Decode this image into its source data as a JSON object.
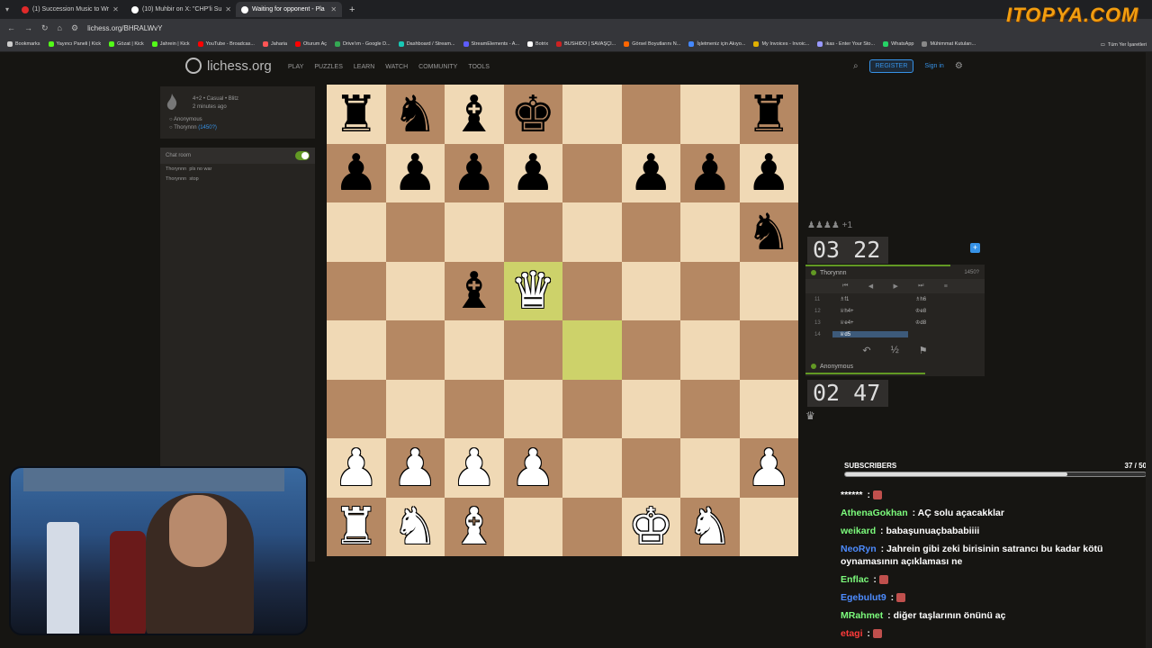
{
  "tabs": [
    {
      "label": "(1) Succession Music to Wr",
      "favicon_color": "#e02a2a",
      "active": false
    },
    {
      "label": "(10) Muhbir on X: \"CHP'li Su",
      "favicon_color": "#ffffff",
      "active": false
    },
    {
      "label": "Waiting for opponent - Pla",
      "favicon_color": "#ffffff",
      "active": true
    }
  ],
  "new_tab": "+",
  "url": "lichess.org/BHRALWvY",
  "bookmarks": [
    {
      "label": "Bookmarks",
      "color": "#cccccc"
    },
    {
      "label": "Yayıncı Paneli | Kick",
      "color": "#53fc18"
    },
    {
      "label": "Gözat | Kick",
      "color": "#53fc18"
    },
    {
      "label": "Jahrein | Kick",
      "color": "#53fc18"
    },
    {
      "label": "YouTube - Broadcas...",
      "color": "#ff0000"
    },
    {
      "label": "Jaharia",
      "color": "#ff5555"
    },
    {
      "label": "Oturum Aç",
      "color": "#ff0000"
    },
    {
      "label": "Drive'ım - Google D...",
      "color": "#34a853"
    },
    {
      "label": "Dashboard / Stream...",
      "color": "#18c8b5"
    },
    {
      "label": "StreamElements - A...",
      "color": "#5d5dff"
    },
    {
      "label": "Botrix",
      "color": "#ffffff"
    },
    {
      "label": "BUSHIDO | SAVAŞÇI...",
      "color": "#cc2222"
    },
    {
      "label": "Görsel Boyutlarını N...",
      "color": "#ff6600"
    },
    {
      "label": "İşletmeniz için Akıyo...",
      "color": "#4488ff"
    },
    {
      "label": "My Invoices - Invoic...",
      "color": "#e0b000"
    },
    {
      "label": "ikas - Enter Your Sto...",
      "color": "#9999ff"
    },
    {
      "label": "WhatsApp",
      "color": "#25d366"
    },
    {
      "label": "Mühimmat Kutuları...",
      "color": "#888888"
    }
  ],
  "bookmarks_right": "Tüm Yer İşaretleri",
  "site": {
    "logo": "lichess.org",
    "nav": [
      "PLAY",
      "PUZZLES",
      "LEARN",
      "WATCH",
      "COMMUNITY",
      "TOOLS"
    ],
    "register": "REGISTER",
    "signin": "Sign in"
  },
  "game_info": {
    "type": "4+2 • Casual • Blitz",
    "time_ago": "2 minutes ago",
    "white_player": "Anonymous",
    "black_player": "Thorynnn",
    "black_rating": "(1450?)"
  },
  "chat_room": {
    "title": "Chat room",
    "messages": [
      {
        "user": "Thorynnn",
        "text": "pls no war"
      },
      {
        "user": "Thorynnn",
        "text": "stop"
      }
    ]
  },
  "board": [
    [
      "br",
      "bn",
      "bb",
      "bk",
      "",
      "",
      "",
      "br"
    ],
    [
      "bp",
      "bp",
      "bp",
      "bp",
      "",
      "bp",
      "bp",
      "bp"
    ],
    [
      "",
      "",
      "",
      "",
      "",
      "",
      "",
      "bn"
    ],
    [
      "",
      "",
      "bb",
      "wq",
      "",
      "",
      "",
      ""
    ],
    [
      "",
      "",
      "",
      "",
      "",
      "",
      "",
      ""
    ],
    [
      "",
      "",
      "",
      "",
      "",
      "",
      "",
      ""
    ],
    [
      "wp",
      "wp",
      "wp",
      "wp",
      "",
      "",
      "",
      "wp"
    ],
    [
      "wr",
      "wn",
      "wb",
      "",
      "",
      "wk",
      "wn",
      ""
    ]
  ],
  "highlights": [
    [
      3,
      3
    ],
    [
      4,
      4
    ]
  ],
  "captured_top": "♟♟♟♟ +1",
  "opponent": {
    "clock": "03 22",
    "name": "Thorynnn",
    "rating": "1450?"
  },
  "player": {
    "clock": "02 47",
    "name": "Anonymous"
  },
  "moves": [
    {
      "n": "11",
      "w": "♗f1",
      "b": "♗h6"
    },
    {
      "n": "12",
      "w": "♕h4+",
      "b": "♔e8"
    },
    {
      "n": "13",
      "w": "♕e4+",
      "b": "♔d8"
    },
    {
      "n": "14",
      "w": "♕d5",
      "b": ""
    }
  ],
  "move_nav": [
    "⏮",
    "◀",
    "▶",
    "⏭",
    "≡"
  ],
  "move_actions": [
    "↶",
    "½",
    "⚑"
  ],
  "brand_overlay": "ITOPYA.COM",
  "subscribers": {
    "label": "SUBSCRIBERS",
    "count": "37 / 50",
    "progress": 0.74
  },
  "stream_chat": [
    {
      "user": "******",
      "color": "#ffffff",
      "text": ""
    },
    {
      "user": "AthenaGokhan",
      "color": "#7cfc7c",
      "text": "AÇ solu açacakklar"
    },
    {
      "user": "weikard",
      "color": "#7cfc7c",
      "text": "babaşunuaçbababiiii"
    },
    {
      "user": "NeoRyn",
      "color": "#4d8cff",
      "text": "Jahrein gibi zeki birisinin satrancı bu kadar kötü oynamasının açıklaması ne"
    },
    {
      "user": "Enflac",
      "color": "#7cfc7c",
      "text": ""
    },
    {
      "user": "Egebulut9",
      "color": "#4d8cff",
      "text": ""
    },
    {
      "user": "MRahmet",
      "color": "#7cfc7c",
      "text": "diğer taşlarının önünü aç"
    },
    {
      "user": "etagi",
      "color": "#ff3b3b",
      "text": ""
    }
  ]
}
